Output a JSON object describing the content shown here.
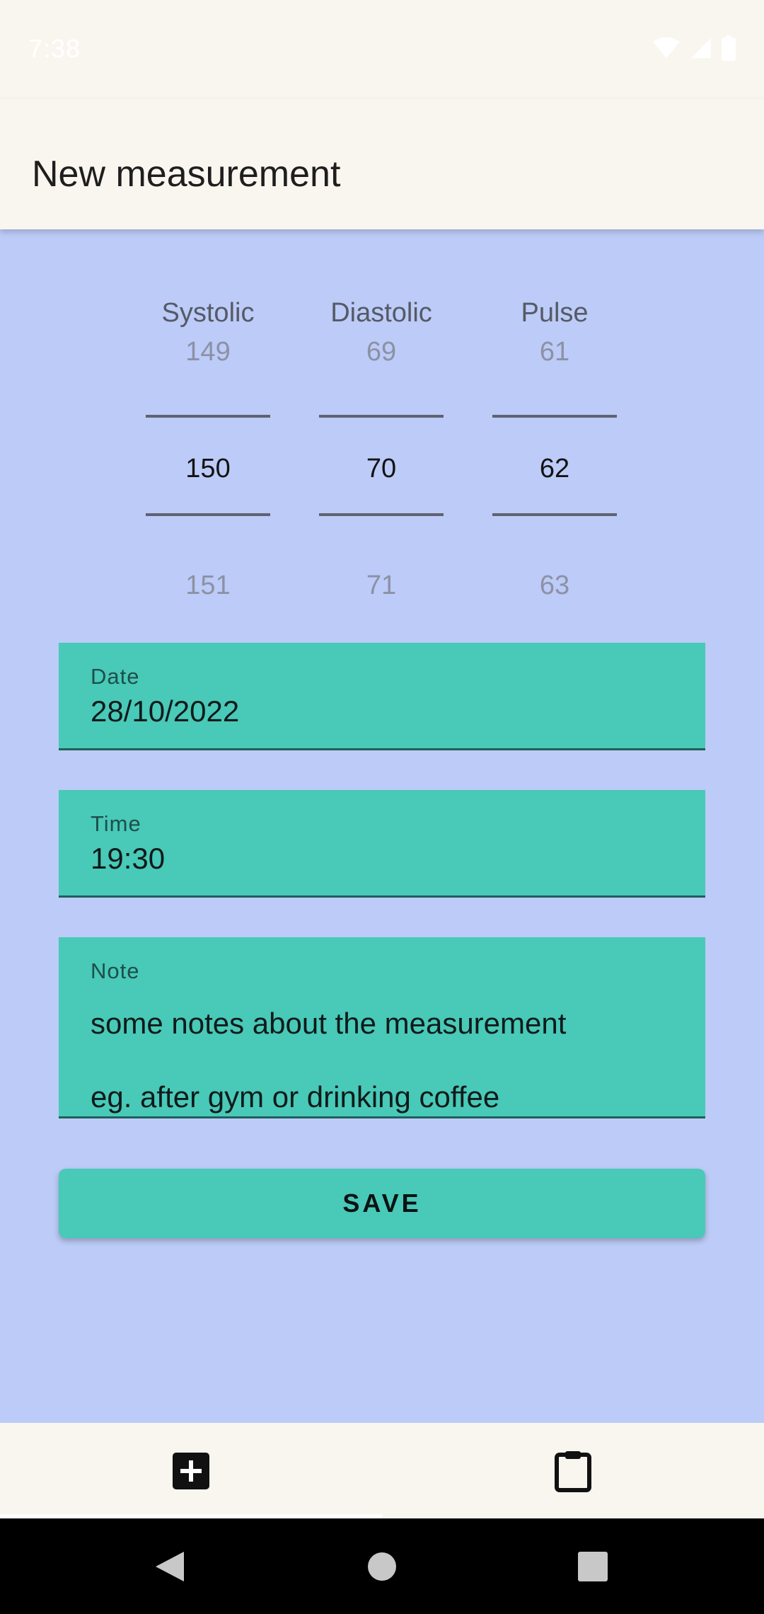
{
  "status_bar": {
    "time": "7:38",
    "icons": [
      "wifi-icon",
      "signal-icon",
      "battery-icon"
    ]
  },
  "app_bar": {
    "title": "New measurement"
  },
  "pickers": {
    "systolic": {
      "label": "Systolic",
      "prev": "149",
      "value": "150",
      "next": "151"
    },
    "diastolic": {
      "label": "Diastolic",
      "prev": "69",
      "value": "70",
      "next": "71"
    },
    "pulse": {
      "label": "Pulse",
      "prev": "61",
      "value": "62",
      "next": "63"
    }
  },
  "fields": {
    "date": {
      "label": "Date",
      "value": "28/10/2022"
    },
    "time": {
      "label": "Time",
      "value": "19:30"
    },
    "note": {
      "label": "Note",
      "line1": "some notes about the measurement",
      "line2": "eg. after gym or drinking coffee"
    }
  },
  "actions": {
    "save_label": "SAVE"
  },
  "bottom_nav": {
    "items": [
      {
        "icon": "add-box-icon",
        "selected": true
      },
      {
        "icon": "clipboard-icon",
        "selected": false
      }
    ]
  },
  "system_nav": {
    "icons": [
      "back-icon",
      "home-icon",
      "recents-icon"
    ]
  },
  "colors": {
    "background": "#bccbf7",
    "bar": "#f9f6ef",
    "accent": "#49c9b8",
    "field_underline": "#1f5f5c"
  }
}
